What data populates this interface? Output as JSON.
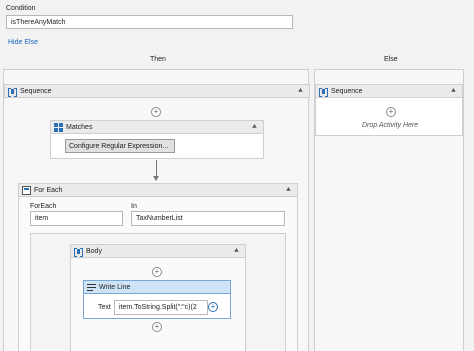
{
  "condition": {
    "label": "Condition",
    "value": "isThereAnyMatch",
    "hide_else": "Hide Else"
  },
  "columns": {
    "then": "Then",
    "else": "Else"
  },
  "then_sequence": {
    "title": "Sequence",
    "matches": {
      "title": "Matches",
      "button": "Configure Regular Expression..."
    },
    "for_each": {
      "title": "For Each",
      "foreach_label": "ForEach",
      "foreach_value": "item",
      "in_label": "In",
      "in_value": "TaxNumberList",
      "body": {
        "title": "Body",
        "write_line": {
          "title": "Write Line",
          "text_label": "Text",
          "text_value": "item.ToString.Split(\":\"c)(2"
        }
      }
    }
  },
  "else_sequence": {
    "title": "Sequence",
    "drop_hint": "Drop Activity Here"
  },
  "icons": {
    "sequence": "sequence-icon",
    "matches": "regex-matches-icon",
    "for_each": "for-each-icon",
    "body": "body-icon",
    "write_line": "write-line-icon",
    "collapse": "double-chevron-up-icon",
    "add": "plus-circle-icon"
  }
}
